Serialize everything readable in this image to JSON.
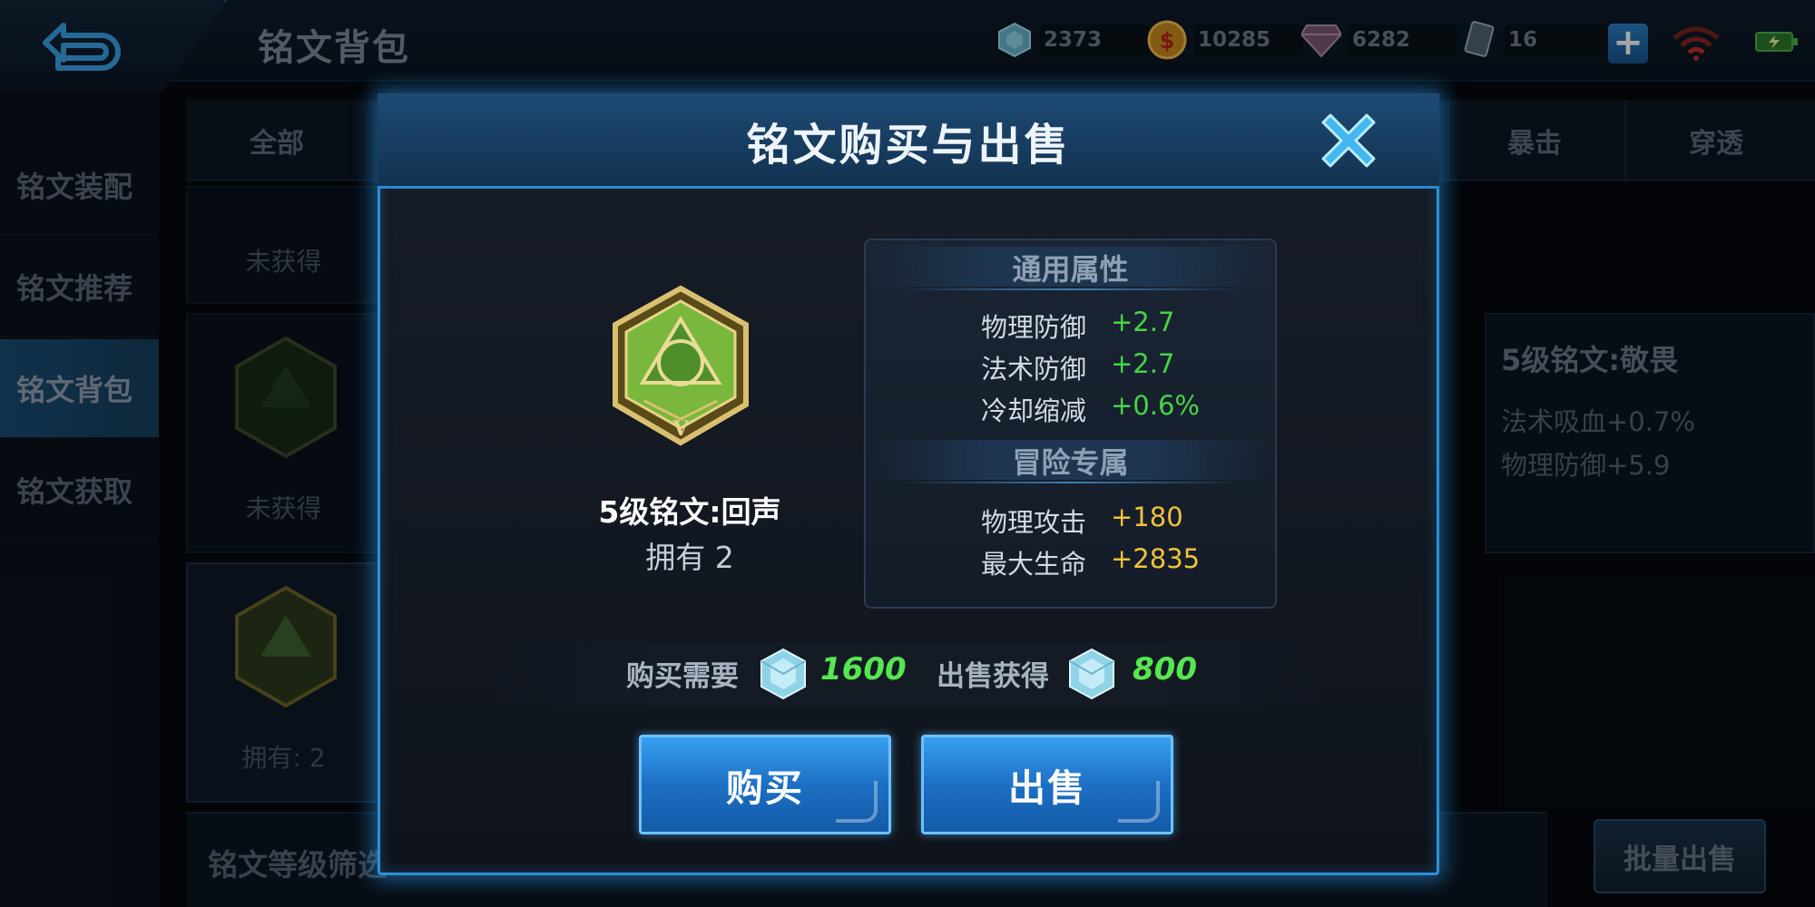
{
  "header": {
    "title": "铭文背包"
  },
  "currencies": {
    "gems": "2373",
    "coins": "10285",
    "diamonds": "6282",
    "cards": "16"
  },
  "sidebar": {
    "items": [
      {
        "label": "铭文装配"
      },
      {
        "label": "铭文推荐"
      },
      {
        "label": "铭文背包"
      },
      {
        "label": "铭文获取"
      }
    ]
  },
  "filters": {
    "all": "全部",
    "crit": "暴击",
    "pierce": "穿透"
  },
  "bg_cards": {
    "not_obtained_1": "未获得",
    "not_obtained_2": "未获得",
    "owned": "拥有: 2"
  },
  "detail": {
    "title": "5级铭文:敬畏",
    "line1": "法术吸血+0.7%",
    "line2": "物理防御+5.9"
  },
  "grade_filter": {
    "label": "铭文等级筛选"
  },
  "bulk_sell": {
    "label": "批量出售"
  },
  "modal": {
    "title": "铭文购买与出售",
    "rune_name": "5级铭文:回声",
    "owned": "拥有 2",
    "general_header": "通用属性",
    "general_stats": [
      {
        "name": "物理防御",
        "value": "+2.7"
      },
      {
        "name": "法术防御",
        "value": "+2.7"
      },
      {
        "name": "冷却缩减",
        "value": "+0.6%"
      }
    ],
    "adventure_header": "冒险专属",
    "adventure_stats": [
      {
        "name": "物理攻击",
        "value": "+180"
      },
      {
        "name": "最大生命",
        "value": "+2835"
      }
    ],
    "buy_label": "购买需要",
    "buy_price": "1600",
    "sell_label": "出售获得",
    "sell_price": "800",
    "buy_button": "购买",
    "sell_button": "出售"
  },
  "colors": {
    "accent": "#2f8fd6",
    "general_value": "#45d545",
    "adventure_value": "#f0c23a",
    "price": "#56e64f"
  }
}
